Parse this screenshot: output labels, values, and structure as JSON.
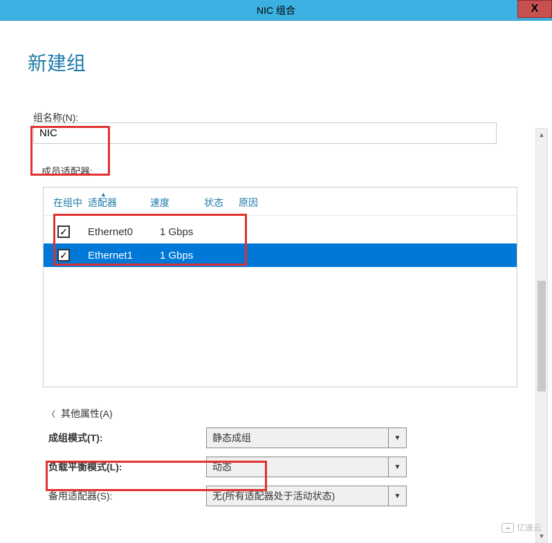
{
  "window": {
    "title": "NIC 组合",
    "close": "X"
  },
  "page": {
    "title": "新建组"
  },
  "group_name": {
    "label": "组名称(N):",
    "value": "NIC"
  },
  "adapters": {
    "label": "成员适配器:",
    "columns": {
      "in_group": "在组中",
      "adapter": "适配器",
      "speed": "速度",
      "status": "状态",
      "reason": "原因"
    },
    "rows": [
      {
        "checked": true,
        "name": "Ethernet0",
        "speed": "1 Gbps",
        "status": "",
        "reason": "",
        "selected": false
      },
      {
        "checked": true,
        "name": "Ethernet1",
        "speed": "1 Gbps",
        "status": "",
        "reason": "",
        "selected": true
      }
    ]
  },
  "other_props": {
    "label": "其他属性(A)",
    "teaming_mode": {
      "label": "成组模式(T):",
      "value": "静态成组"
    },
    "lb_mode": {
      "label": "负载平衡模式(L):",
      "value": "动态"
    },
    "standby": {
      "label": "备用适配器(S):",
      "value": "无(所有适配器处于活动状态)"
    }
  },
  "watermark": "亿速云"
}
